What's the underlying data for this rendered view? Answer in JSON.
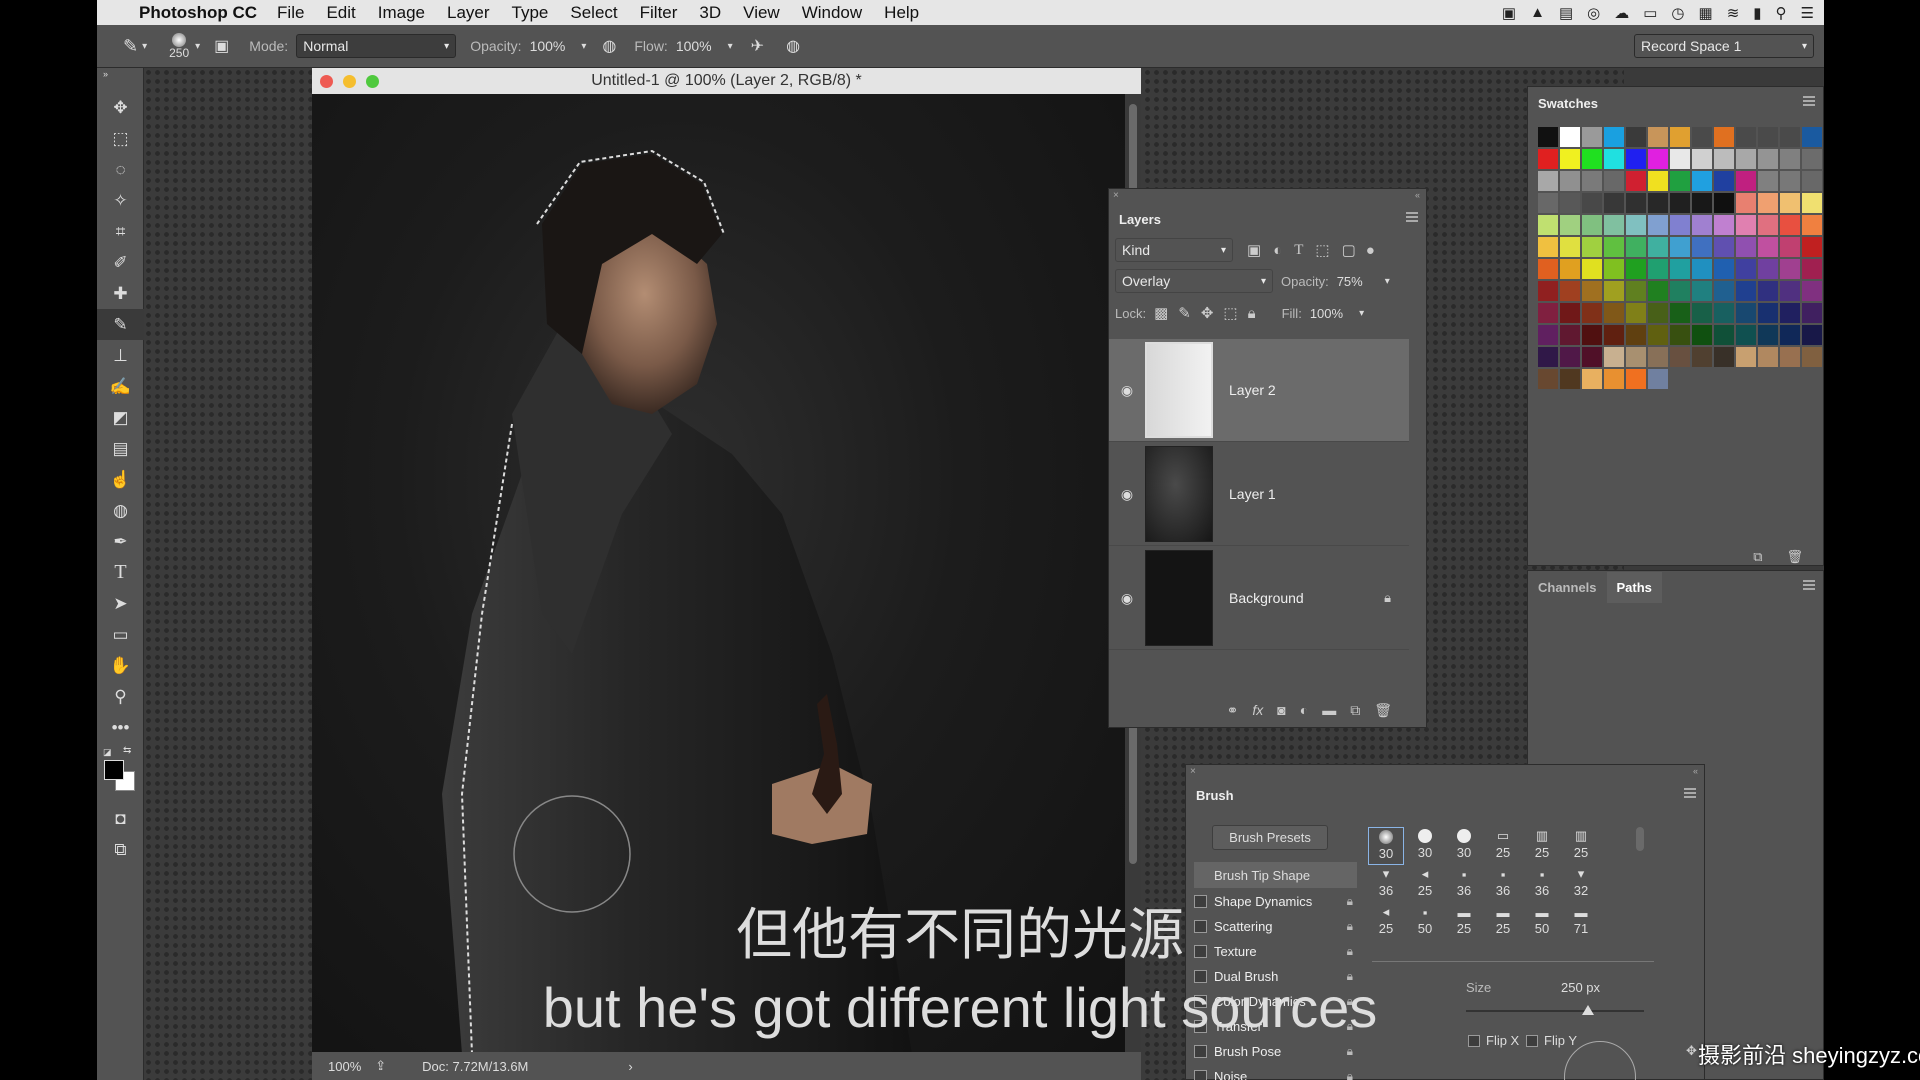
{
  "menubar": {
    "app_name": "Photoshop CC",
    "items": [
      "File",
      "Edit",
      "Image",
      "Layer",
      "Type",
      "Select",
      "Filter",
      "3D",
      "View",
      "Window",
      "Help"
    ]
  },
  "options_bar": {
    "brush_size": "250",
    "mode_label": "Mode:",
    "mode_value": "Normal",
    "opacity_label": "Opacity:",
    "opacity_value": "100%",
    "flow_label": "Flow:",
    "flow_value": "100%",
    "workspace": "Record Space 1"
  },
  "document": {
    "title": "Untitled-1 @ 100% (Layer 2, RGB/8) *",
    "zoom": "100%",
    "doc_info": "Doc: 7.72M/13.6M"
  },
  "layers_panel": {
    "title": "Layers",
    "filter_kind": "Kind",
    "blend_mode": "Overlay",
    "opacity_label": "Opacity:",
    "opacity_value": "75%",
    "lock_label": "Lock:",
    "fill_label": "Fill:",
    "fill_value": "100%",
    "layers": [
      {
        "name": "Layer 2",
        "visible": true,
        "selected": true
      },
      {
        "name": "Layer 1",
        "visible": true,
        "selected": false
      },
      {
        "name": "Background",
        "visible": true,
        "selected": false,
        "locked": true
      }
    ]
  },
  "swatches_panel": {
    "title": "Swatches",
    "colors": [
      "#111111",
      "#ffffff",
      "#9a9a9a",
      "#1aa0e0",
      "#3a3a3a",
      "#c8955a",
      "#e0a030",
      "#4a4a4a",
      "#e07020",
      "#4a4a4a",
      "#4a4a4a",
      "#4a4a4a",
      "#1a5aa0",
      "#e02020",
      "#f0f020",
      "#20e020",
      "#20e0e0",
      "#2020f0",
      "#e020e0",
      "#e8e8e8",
      "#d0d0d0",
      "#bcbcbc",
      "#a8a8a8",
      "#949494",
      "#808080",
      "#6c6c6c",
      "#a8a8a8",
      "#909090",
      "#7a7a7a",
      "#686868",
      "#d02030",
      "#f0e020",
      "#20a040",
      "#20a0e0",
      "#2040a0",
      "#c02080",
      "#808080",
      "#787878",
      "#686868",
      "#686868",
      "#585858",
      "#484848",
      "#383838",
      "#303030",
      "#282828",
      "#202020",
      "#181818",
      "#101010",
      "#e88070",
      "#f0a070",
      "#f0c070",
      "#f0e070",
      "#c0e070",
      "#a0d080",
      "#80c080",
      "#80c0a0",
      "#80c0c0",
      "#80a0d0",
      "#8080d0",
      "#a080d0",
      "#c080d0",
      "#e080b0",
      "#e07080",
      "#e85040",
      "#f08040",
      "#f0c040",
      "#e0e040",
      "#a0d040",
      "#60c040",
      "#40b060",
      "#40b0a0",
      "#40a0d0",
      "#4070c0",
      "#6050b0",
      "#9050b0",
      "#c050a0",
      "#c04070",
      "#c02020",
      "#e06020",
      "#e0a020",
      "#e0e020",
      "#80c020",
      "#20a020",
      "#20a070",
      "#20a0a0",
      "#2090c0",
      "#2060b0",
      "#4040a0",
      "#7040a0",
      "#a04090",
      "#a02050",
      "#902020",
      "#a04020",
      "#a07020",
      "#a0a020",
      "#608020",
      "#208020",
      "#208060",
      "#208080",
      "#206090",
      "#204090",
      "#303080",
      "#503080",
      "#803080",
      "#802040",
      "#701818",
      "#803018",
      "#805818",
      "#808018",
      "#486018",
      "#186018",
      "#186048",
      "#186060",
      "#184870",
      "#183070",
      "#202060",
      "#402060",
      "#602060",
      "#601830",
      "#501010",
      "#602010",
      "#604010",
      "#606010",
      "#385010",
      "#105010",
      "#105038",
      "#105050",
      "#103858",
      "#102858",
      "#181848",
      "#301848",
      "#501848",
      "#501028",
      "#c8b090",
      "#a89070",
      "#887058",
      "#685040",
      "#504030",
      "#383028",
      "#c8a070",
      "#b08860",
      "#987050",
      "#806040",
      "#684830",
      "#503820",
      "#e8b060",
      "#e89030",
      "#f07020",
      "#7080a0"
    ]
  },
  "channels_panel": {
    "tabs": [
      "Channels",
      "Paths"
    ],
    "active": "Paths"
  },
  "brush_panel": {
    "title": "Brush",
    "presets_button": "Brush Presets",
    "tip_shape_label": "Brush Tip Shape",
    "options": [
      "Shape Dynamics",
      "Scattering",
      "Texture",
      "Dual Brush",
      "Color Dynamics",
      "Transfer",
      "Brush Pose",
      "Noise"
    ],
    "tip_sizes": [
      "30",
      "30",
      "30",
      "25",
      "25",
      "25",
      "36",
      "25",
      "36",
      "36",
      "36",
      "32",
      "25",
      "50",
      "25",
      "25",
      "50",
      "71"
    ],
    "size_label": "Size",
    "size_value": "250 px",
    "flip_x": "Flip X",
    "flip_y": "Flip Y"
  },
  "subtitles": {
    "line1": "但他有不同的光源",
    "line2": "but he's got different light sources"
  },
  "watermark": "摄影前沿 sheyingzyz.com"
}
